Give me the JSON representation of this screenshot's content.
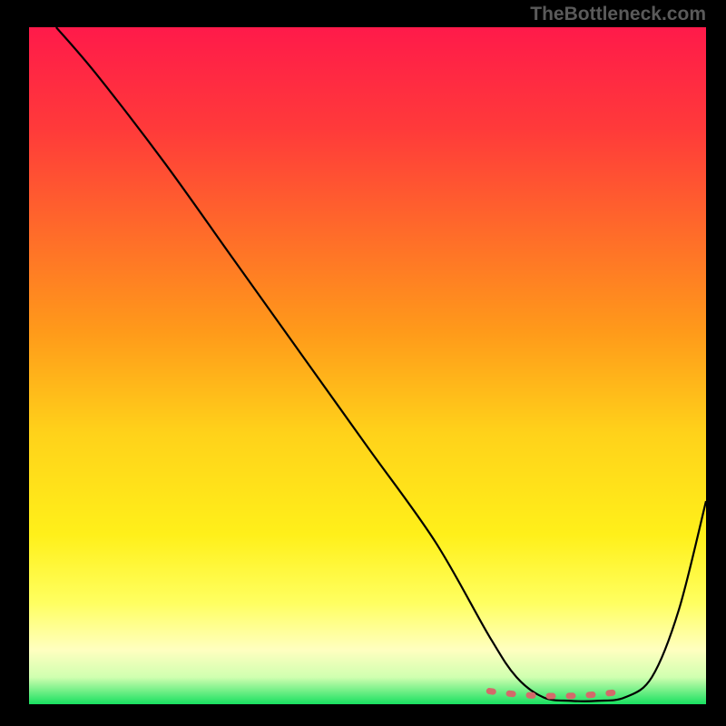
{
  "watermark": "TheBottleneck.com",
  "chart_data": {
    "type": "line",
    "title": "",
    "xlabel": "",
    "ylabel": "",
    "xlim": [
      0,
      100
    ],
    "ylim": [
      0,
      100
    ],
    "curve": {
      "name": "bottleneck-curve",
      "x": [
        4,
        10,
        20,
        30,
        40,
        50,
        60,
        68,
        72,
        76,
        80,
        84,
        88,
        92,
        96,
        100
      ],
      "y": [
        100,
        93,
        80,
        66,
        52,
        38,
        24,
        10,
        4,
        1,
        0.5,
        0.5,
        1,
        4,
        14,
        30
      ]
    },
    "optimal_band": {
      "x_start": 68,
      "x_end": 88,
      "y_approx": 1
    },
    "gradient_stops": [
      {
        "pos": 0.0,
        "color": "#ff1a4a"
      },
      {
        "pos": 0.15,
        "color": "#ff3a3a"
      },
      {
        "pos": 0.3,
        "color": "#ff6a2a"
      },
      {
        "pos": 0.45,
        "color": "#ff9a1a"
      },
      {
        "pos": 0.6,
        "color": "#ffd21a"
      },
      {
        "pos": 0.75,
        "color": "#fff01a"
      },
      {
        "pos": 0.85,
        "color": "#ffff60"
      },
      {
        "pos": 0.92,
        "color": "#ffffc0"
      },
      {
        "pos": 0.96,
        "color": "#d0ffb0"
      },
      {
        "pos": 1.0,
        "color": "#18e060"
      }
    ]
  }
}
